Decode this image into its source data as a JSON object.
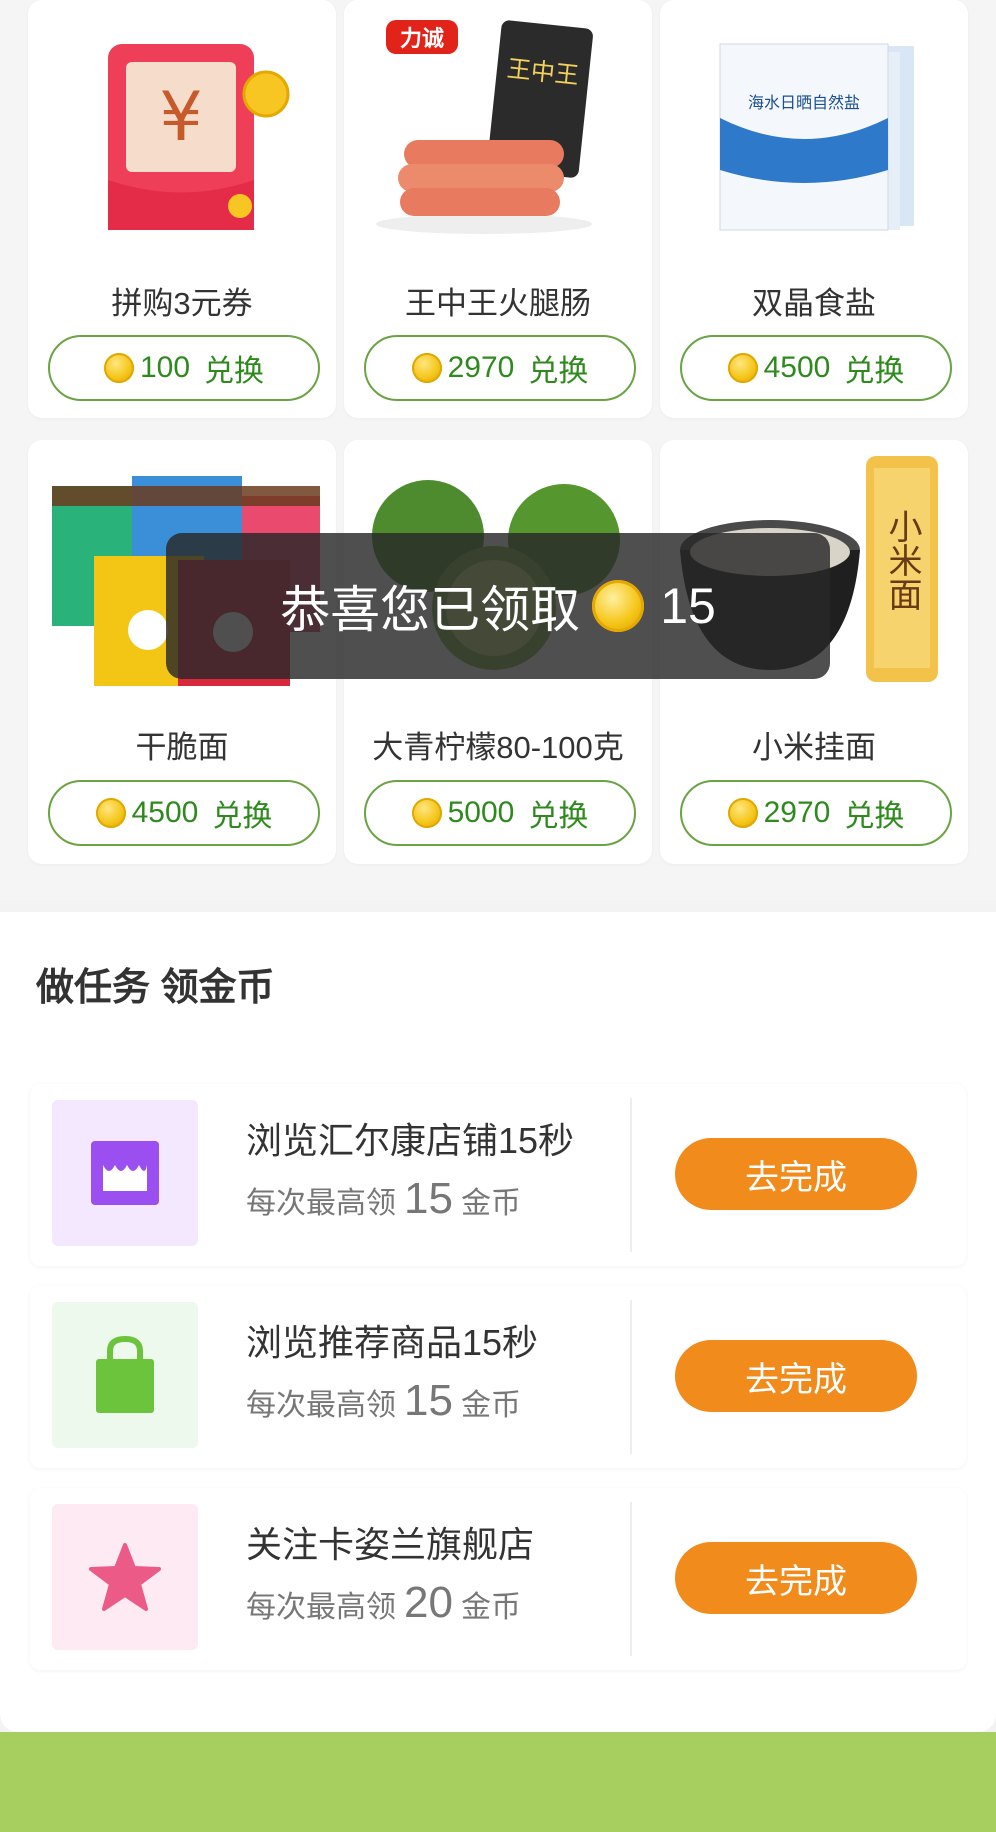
{
  "products": [
    {
      "name": "拼购3元券",
      "points": "100",
      "action": "兑换",
      "image": "red-envelope-coupon"
    },
    {
      "name": "王中王火腿肠",
      "points": "2970",
      "action": "兑换",
      "image": "ham-sausage",
      "brand_logo": "力诚"
    },
    {
      "name": "双晶食盐",
      "points": "4500",
      "action": "兑换",
      "image": "salt-bags",
      "package_text": "海水日晒自然盐"
    },
    {
      "name": "干脆面",
      "points": "4500",
      "action": "兑换",
      "image": "crispy-noodle-packs"
    },
    {
      "name": "大青柠檬80-100克",
      "points": "5000",
      "action": "兑换",
      "image": "green-limes"
    },
    {
      "name": "小米挂面",
      "points": "2970",
      "action": "兑换",
      "image": "millet-noodles",
      "package_text": "小米面"
    }
  ],
  "toast": {
    "text": "恭喜您已领取",
    "amount": "15"
  },
  "tasks_section": {
    "title": "做任务 领金币",
    "items": [
      {
        "title": "浏览汇尔康店铺15秒",
        "reward_prefix": "每次最高领",
        "reward_amount": "15",
        "reward_suffix": "金币",
        "button": "去完成",
        "icon": "store-icon",
        "icon_bg": "#f3e8ff",
        "icon_color": "#9b4ff0"
      },
      {
        "title": "浏览推荐商品15秒",
        "reward_prefix": "每次最高领",
        "reward_amount": "15",
        "reward_suffix": "金币",
        "button": "去完成",
        "icon": "shopping-bag-icon",
        "icon_bg": "#eef9ee",
        "icon_color": "#6cc33c"
      },
      {
        "title": "关注卡姿兰旗舰店",
        "reward_prefix": "每次最高领",
        "reward_amount": "20",
        "reward_suffix": "金币",
        "button": "去完成",
        "icon": "star-icon",
        "icon_bg": "#fdeaf3",
        "icon_color": "#ec5a87"
      }
    ]
  },
  "colors": {
    "accent_green": "#2f8a1e",
    "button_orange": "#f08b1c",
    "footer_green": "#a6cf5f"
  }
}
